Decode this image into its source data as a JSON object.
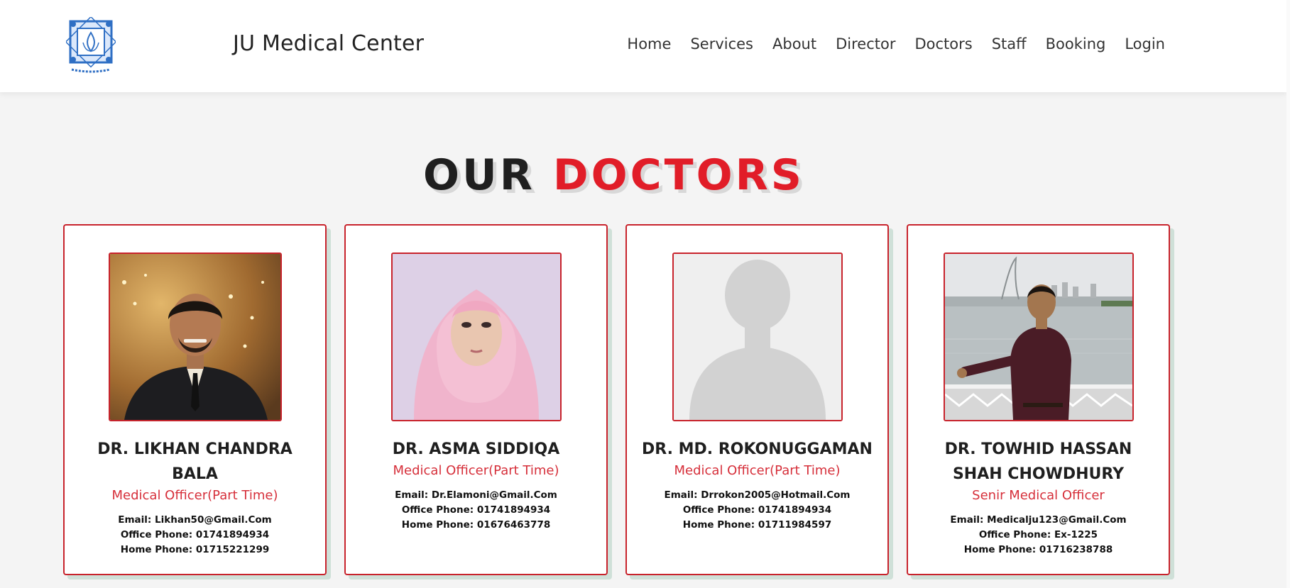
{
  "header": {
    "brand": "JU Medical Center",
    "nav": [
      "Home",
      "Services",
      "About",
      "Director",
      "Doctors",
      "Staff",
      "Booking",
      "Login"
    ]
  },
  "section": {
    "title_part1": "OUR",
    "title_part2": "DOCTORS"
  },
  "doctors": [
    {
      "name": "DR. LIKHAN CHANDRA BALA",
      "role": "Medical Officer(Part Time)",
      "email": "Email: Likhan50@Gmail.Com",
      "office": "Office Phone: 01741894934",
      "home": "Home Phone: 01715221299"
    },
    {
      "name": "DR. ASMA SIDDIQA",
      "role": "Medical Officer(Part Time)",
      "email": "Email: Dr.Elamoni@Gmail.Com",
      "office": "Office Phone: 01741894934",
      "home": "Home Phone: 01676463778"
    },
    {
      "name": "DR. MD. ROKONUGGAMAN",
      "role": "Medical Officer(Part Time)",
      "email": "Email: Drrokon2005@Hotmail.Com",
      "office": "Office Phone: 01741894934",
      "home": "Home Phone: 01711984597"
    },
    {
      "name": "DR. TOWHID HASSAN SHAH CHOWDHURY",
      "role": "Senir Medical Officer",
      "email": "Email: Medicalju123@Gmail.Com",
      "office": "Office Phone: Ex-1225",
      "home": "Home Phone: 01716238788"
    }
  ],
  "colors": {
    "accent_red": "#e11d28",
    "card_border": "#c8232c",
    "card_shadow": "#cfe0d8"
  },
  "icons": {
    "logo": "university-emblem-icon"
  }
}
